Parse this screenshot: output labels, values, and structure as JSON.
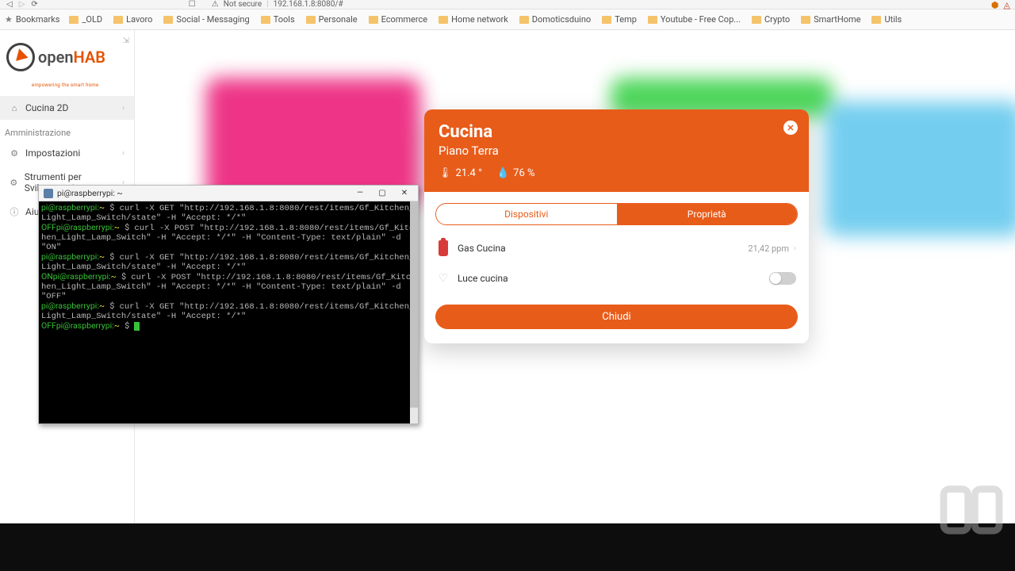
{
  "browser": {
    "security_label": "Not secure",
    "url": "192.168.1.8:8080/#"
  },
  "bookmarks": {
    "star_label": "Bookmarks",
    "folders": [
      "_OLD",
      "Lavoro",
      "Social - Messaging",
      "Tools",
      "Personale",
      "Ecommerce",
      "Home network",
      "Domoticsduino",
      "Temp",
      "Youtube - Free Cop...",
      "Crypto",
      "SmartHome",
      "Utils"
    ]
  },
  "sidebar": {
    "logo_main": "open",
    "logo_accent": "HAB",
    "logo_sub": "empowering the smart home",
    "items": [
      {
        "label": "Cucina 2D",
        "icon": "⌂",
        "selected": true,
        "chev": true
      }
    ],
    "section_label": "Amministrazione",
    "admin_items": [
      {
        "label": "Impostazioni",
        "icon": "⚙",
        "chev": true
      },
      {
        "label": "Strumenti per Sviluppatori",
        "icon": "⚙",
        "chev": true
      },
      {
        "label": "Aiuto e",
        "icon": "ⓘ",
        "chev": false
      }
    ]
  },
  "room": {
    "title": "Cucina",
    "floor": "Piano Terra",
    "temp": "21.4 °",
    "humidity": "76 %",
    "tabs": {
      "left": "Dispositivi",
      "right": "Proprietà"
    },
    "devices": [
      {
        "name": "Gas Cucina",
        "value": "21,42 ppm",
        "type": "gas"
      },
      {
        "name": "Luce cucina",
        "value": "",
        "type": "light",
        "toggle": false
      }
    ],
    "close_button": "Chiudi"
  },
  "terminal": {
    "title": "pi@raspberrypi: ~",
    "lines": [
      {
        "p": "pi@raspberrypi:",
        "t": "~",
        "d": "$",
        "c": "curl -X GET \"http://192.168.1.8:8080/rest/items/Gf_Kitchen_Light_Lamp_Switch/state\" -H \"Accept: */*\""
      },
      {
        "r": "OFF",
        "p": "pi@raspberrypi:",
        "t": "~",
        "d": "$",
        "c": "curl -X POST \"http://192.168.1.8:8080/rest/items/Gf_Kitchen_Light_Lamp_Switch\" -H \"Accept: */*\" -H \"Content-Type: text/plain\" -d \"ON\""
      },
      {
        "p": "pi@raspberrypi:",
        "t": "~",
        "d": "$",
        "c": "curl -X GET \"http://192.168.1.8:8080/rest/items/Gf_Kitchen_Light_Lamp_Switch/state\" -H \"Accept: */*\""
      },
      {
        "r": "ON",
        "p": "pi@raspberrypi:",
        "t": "~",
        "d": "$",
        "c": "curl -X POST \"http://192.168.1.8:8080/rest/items/Gf_Kitchen_Light_Lamp_Switch\" -H \"Accept: */*\" -H \"Content-Type: text/plain\" -d \"OFF\""
      },
      {
        "p": "pi@raspberrypi:",
        "t": "~",
        "d": "$",
        "c": "curl -X GET \"http://192.168.1.8:8080/rest/items/Gf_Kitchen_Light_Lamp_Switch/state\" -H \"Accept: */*\""
      },
      {
        "r": "OFF",
        "p": "pi@raspberrypi:",
        "t": "~",
        "d": "$",
        "c": "",
        "cursor": true
      }
    ]
  }
}
